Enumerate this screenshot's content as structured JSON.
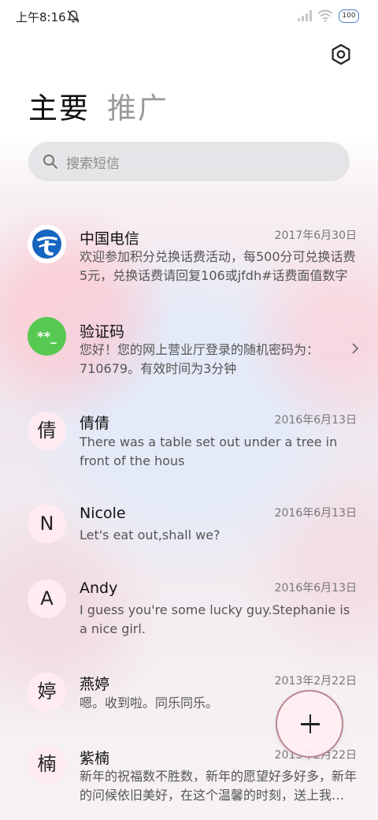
{
  "status_bar": {
    "time": "上午8:16",
    "battery": "100"
  },
  "tabs": [
    {
      "label": "主要",
      "active": true
    },
    {
      "label": "推广",
      "active": false
    }
  ],
  "search": {
    "placeholder": "搜索短信"
  },
  "conversations": [
    {
      "name": "中国电信",
      "date": "2017年6月30日",
      "preview": "欢迎参加积分兑换话费活动，每500分可兑换话费5元，兑换话费请回复106或jfdh#话费面值数字",
      "avatar_type": "china-telecom-logo"
    },
    {
      "name": "验证码",
      "date": "",
      "preview": "您好！您的网上营业厅登录的随机密码为：710679。有效时间为3分钟",
      "avatar_text": "**_",
      "avatar_color": "#57c952"
    },
    {
      "name": "倩倩",
      "date": "2016年6月13日",
      "preview": "There was a table set out under a tree in front of the hous",
      "avatar_text": "倩"
    },
    {
      "name": "Nicole",
      "date": "2016年6月13日",
      "preview": "Let's eat out,shall we?",
      "avatar_text": "N"
    },
    {
      "name": "Andy",
      "date": "2016年6月13日",
      "preview": "I guess you're some lucky guy.Stephanie is a nice girl.",
      "avatar_text": "A"
    },
    {
      "name": "燕婷",
      "date": "2013年2月22日",
      "preview": "嗯。收到啦。同乐同乐。",
      "avatar_text": "婷"
    },
    {
      "name": "紫楠",
      "date": "2013年2月22日",
      "preview": "新年的祝福数不胜数，新年的愿望好多好多，新年的问候依旧美好，在这个温馨的时刻，送上我最真挚的祝福",
      "avatar_text": "楠"
    }
  ],
  "colors": {
    "telecom_blue": "#1565c0",
    "fab_border": "#b9858f"
  },
  "icons": {
    "settings": "settings-hexagon-icon",
    "fab": "plus-icon"
  }
}
